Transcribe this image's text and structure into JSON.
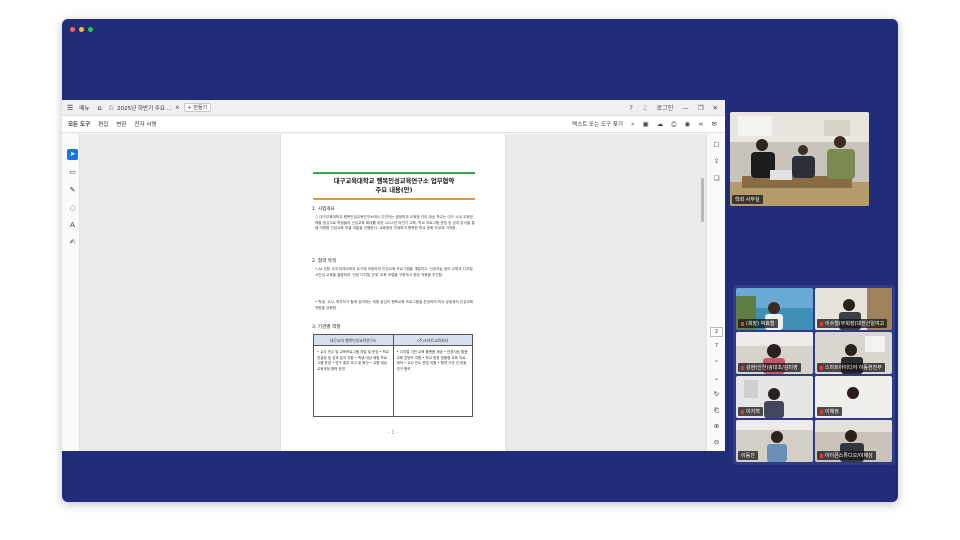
{
  "window": {
    "traffic_lights": [
      "#ff5f57",
      "#febc2e",
      "#28c840"
    ]
  },
  "tabbar": {
    "menu_label": "메뉴",
    "doc_tab": "2025년 하반기 주요 ...",
    "new_tab": "+ 만들기",
    "login": "로그인"
  },
  "menubar": {
    "items": [
      "모든 도구",
      "편집",
      "변환",
      "전자 서명"
    ],
    "find": "텍스트 또는 도구 찾기"
  },
  "document": {
    "title_line1": "대구교육대학교 행복인성교육연구소 업무협약",
    "title_line2": "주요 내용(안)",
    "sec1": "1. 사업개요",
    "sec1_text": "○ 대구교육대학교 행복인성교육연구소에서 주관하는 중점학교 교육청 관리 대상 학교는 대구 시내 교육정책을 중심으로 학생들의 인성교육 확대를 위한 2025년 하반기 교육, 학교 프로그램 운영 및 성과 분석을 통해 미래형 인성교육 모델 개발을 진행한다. 교육청과 연계하여 행복한 학교 문화 조성에 기여함.",
    "sec2": "2. 협약 목적",
    "sec2_b1": "• AI 전환 시대 미래교육의 요구에 부응하여 인성교육 프로그램을 개발하고, 인공지능 윤리 교육과 디지털 시민성 교육을 결합하여 '인성 디지털 연계' 교육 모델을 구현하고 현장 적용을 추진함.",
    "sec2_b2": "• 학생, 교사, 학부모가 함께 참여하는 체험 중심의 행복교육 프로그램을 운영하여 학교 공동체의 인성교육 역량을 강화함.",
    "sec3": "3. 기관별 역할",
    "table_header_left": "대구교대 행복인성교육연구소",
    "table_header_right": "(주)스마트교육회사",
    "table_left": "• 교사 연수 및 교육프로그램 개발 및 운영 • 학교 컨설팅 및 성과 분석 지원 • 학생 대상 체험 프로그램 운영 • 연구 결과 보고 및 확산 • 교원 대상 교육과정 협력 운영",
    "table_right": "• 디지털 기반 교육 플랫폼 제공 • 인공지능 활용 교육 콘텐츠 지원 • 학교 현장 맞춤형 교육 자료 제작 • 교사 연수 운영 지원 • 협약 기관 간 공동 연구 협력",
    "page_footer": "- 1 -"
  },
  "rightrail": {
    "page_current": "2",
    "page_total": "7"
  },
  "participants": {
    "featured": "학회 사무실",
    "grid": [
      "(회장) 박효철",
      "이수형(부회장)대전신일여고",
      "강현(인천)광대초/김미영",
      "스마트아이디어 이동현전무",
      "이지혁",
      "이혜정",
      "이동진",
      "아이폰스튜디오/이재성"
    ]
  }
}
